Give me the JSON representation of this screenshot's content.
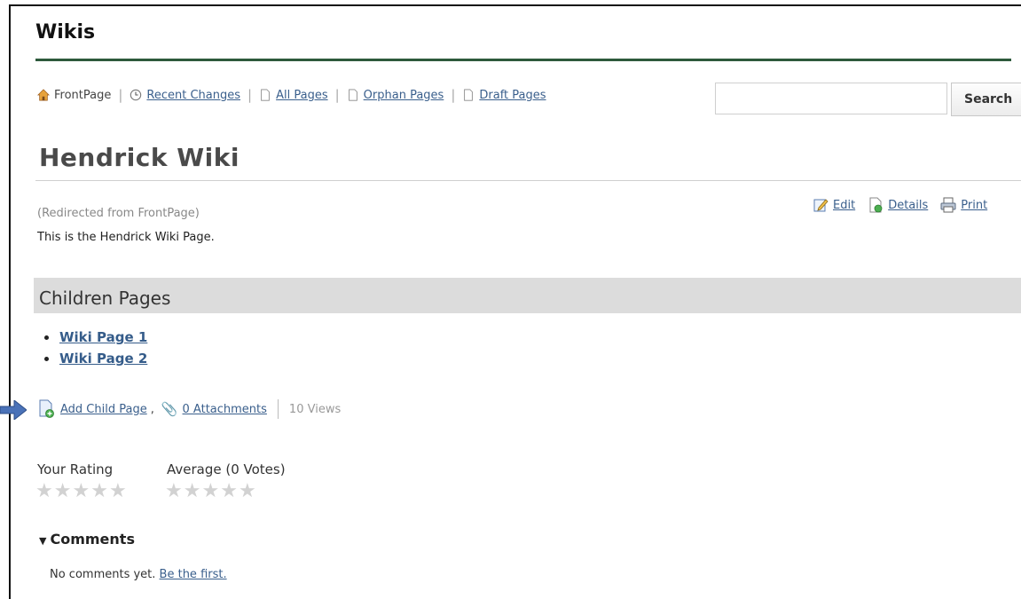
{
  "header": {
    "title": "Wikis"
  },
  "nav": {
    "items": [
      {
        "label": "FrontPage",
        "icon": "home-icon"
      },
      {
        "label": "Recent Changes",
        "icon": "clock-icon"
      },
      {
        "label": "All Pages",
        "icon": "page-icon"
      },
      {
        "label": "Orphan Pages",
        "icon": "page-icon"
      },
      {
        "label": "Draft Pages",
        "icon": "page-icon"
      }
    ]
  },
  "search": {
    "value": "",
    "button_label": "Search"
  },
  "page": {
    "title": "Hendrick Wiki",
    "redirect_note": "(Redirected from FrontPage)",
    "body": "This is the Hendrick Wiki Page."
  },
  "actions": {
    "edit": "Edit",
    "details": "Details",
    "print": "Print"
  },
  "children": {
    "heading": "Children Pages",
    "items": [
      "Wiki Page 1",
      "Wiki Page 2"
    ]
  },
  "meta": {
    "add_child": "Add Child Page",
    "comma": ",",
    "attachments": "0 Attachments",
    "views": "10 Views"
  },
  "rating": {
    "your_label": "Your Rating",
    "average_label": "Average (0 Votes)",
    "your_stars": 0,
    "average_stars": 0,
    "max_stars": 5
  },
  "comments": {
    "heading": "Comments",
    "empty_text": "No comments yet.",
    "cta_link": "Be the first."
  },
  "colors": {
    "link": "#3a5f8c",
    "header_rule": "#2e5a3c",
    "section_bar": "#dcdcdc",
    "star_empty": "#d2d2d2",
    "arrow": "#4a72b8"
  }
}
